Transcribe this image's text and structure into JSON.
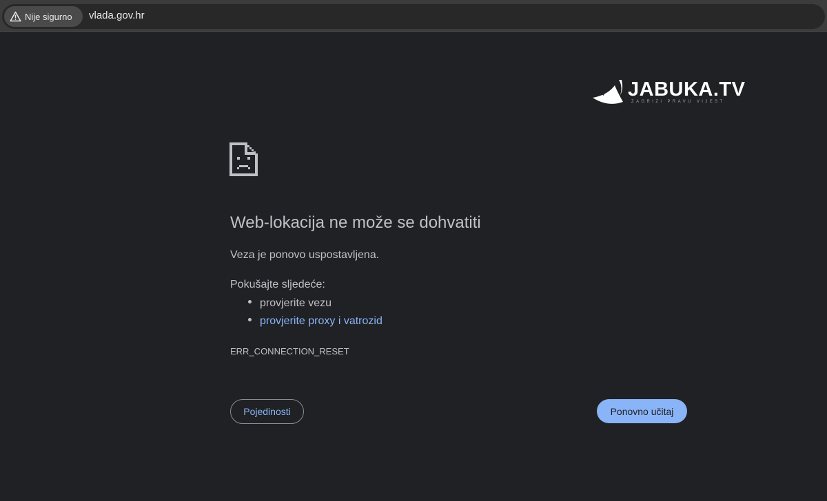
{
  "browser": {
    "security_label": "Nije sigurno",
    "security_icon": "warning-triangle-icon",
    "url": "vlada.gov.hr"
  },
  "watermark": {
    "brand": "JABUKA.TV",
    "tagline": "ZAGRIZI PRAVU VIJEST",
    "icon": "apple-swoosh-logo"
  },
  "error": {
    "icon": "sad-document-icon",
    "title": "Web-lokacija ne može se dohvatiti",
    "subtitle": "Veza je ponovo uspostavljena.",
    "try_label": "Pokušajte sljedeće:",
    "suggestions": [
      {
        "text": "provjerite vezu",
        "link": false
      },
      {
        "text": "provjerite proxy i vatrozid",
        "link": true
      }
    ],
    "code": "ERR_CONNECTION_RESET"
  },
  "buttons": {
    "details": "Pojedinosti",
    "reload": "Ponovno učitaj"
  },
  "colors": {
    "background": "#202124",
    "text": "#bdc1c6",
    "link": "#8ab4f8",
    "primary_button": "#8ab4f8"
  }
}
